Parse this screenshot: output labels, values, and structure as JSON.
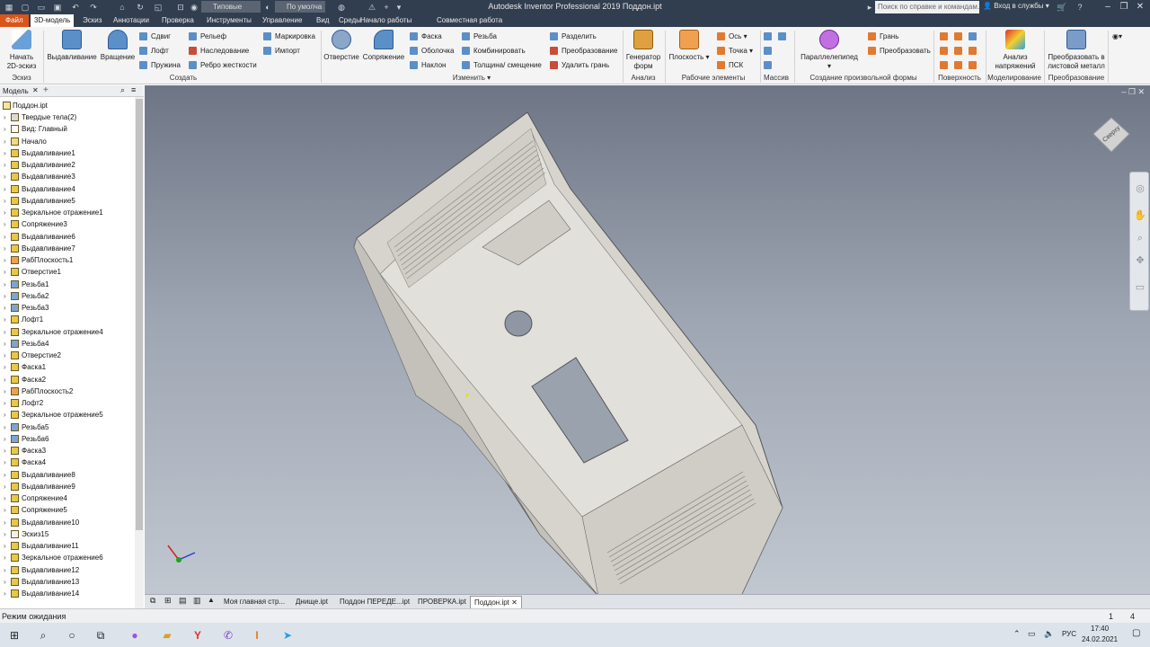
{
  "window": {
    "title": "Autodesk Inventor Professional 2019   Поддон.ipt",
    "help_search_placeholder": "Поиск по справке и командам...",
    "signin": "Вход в службы",
    "appearance_combo": "Типовые",
    "material_combo": "По умолча"
  },
  "ribbon_tabs": [
    "Файл",
    "3D-модель",
    "Эскиз",
    "Аннотации",
    "Проверка",
    "Инструменты",
    "Управление",
    "Вид",
    "Среды",
    "Начало работы",
    "Совместная работа"
  ],
  "ribbon": {
    "panels": {
      "sketch": "Эскиз",
      "create": "Создать",
      "modify": "Изменить",
      "analysis": "Анализ",
      "work_features": "Рабочие элементы",
      "pattern": "Массив",
      "freeform": "Создание произвольной формы",
      "surface": "Поверхность",
      "simulation": "Моделирование",
      "convert": "Преобразование"
    },
    "buttons": {
      "start_sketch": "Начать 2D-эскиз",
      "extrude": "Выдавливание",
      "revolve": "Вращение",
      "sweep": "Сдвиг",
      "loft": "Лофт",
      "coil": "Пружина",
      "emboss": "Рельеф",
      "derive": "Наследование",
      "rib": "Ребро жесткости",
      "decal": "Маркировка",
      "import": "Импорт",
      "hole": "Отверстие",
      "fillet": "Сопряжение",
      "chamfer": "Фаска",
      "shell": "Оболочка",
      "draft": "Наклон",
      "thread": "Резьба",
      "combine": "Комбинировать",
      "thicken": "Толщина/ смещение",
      "split": "Разделить",
      "direct": "Преобразование",
      "delete_face": "Удалить грань",
      "shape_generator": "Генератор форм",
      "plane": "Плоскость",
      "axis": "Ось",
      "point": "Точка",
      "ucs": "ПСК",
      "box": "Параллелепипед",
      "face": "Грань",
      "convert_freeform": "Преобразовать",
      "stress_analysis": "Анализ напряжений",
      "convert_sheet_metal": "Преобразовать в листовой металл"
    }
  },
  "browser": {
    "title": "Модель",
    "root": "Поддон.ipt",
    "items": [
      "Твердые тела(2)",
      "Вид: Главный",
      "Начало",
      "Выдавливание1",
      "Выдавливание2",
      "Выдавливание3",
      "Выдавливание4",
      "Выдавливание5",
      "Зеркальное отражение1",
      "Сопряжение3",
      "Выдавливание6",
      "Выдавливание7",
      "РабПлоскость1",
      "Отверстие1",
      "Резьба1",
      "Резьба2",
      "Резьба3",
      "Лофт1",
      "Зеркальное отражение4",
      "Резьба4",
      "Отверстие2",
      "Фаска1",
      "Фаска2",
      "РабПлоскость2",
      "Лофт2",
      "Зеркальное отражение5",
      "Резьба5",
      "Резьба6",
      "Фаска3",
      "Фаска4",
      "Выдавливание8",
      "Выдавливание9",
      "Сопряжение4",
      "Сопряжение5",
      "Выдавливание10",
      "Эскиз15",
      "Выдавливание11",
      "Зеркальное отражение6",
      "Выдавливание12",
      "Выдавливание13",
      "Выдавливание14"
    ]
  },
  "viewcube_label": "Сверху",
  "document_tabs": [
    "Моя главная стр...",
    "Днище.ipt",
    "Поддон ПЕРЕДЕ...ipt",
    "ПРОВЕРКА.ipt",
    "Поддон.ipt"
  ],
  "status": {
    "text": "Режим ожидания",
    "num1": "1",
    "num2": "4"
  },
  "taskbar": {
    "lang": "РУС",
    "time": "17:40",
    "date": "24.02.2021"
  },
  "colors": {
    "file_tab": "#d9541b",
    "titlebar": "#313e4f"
  }
}
